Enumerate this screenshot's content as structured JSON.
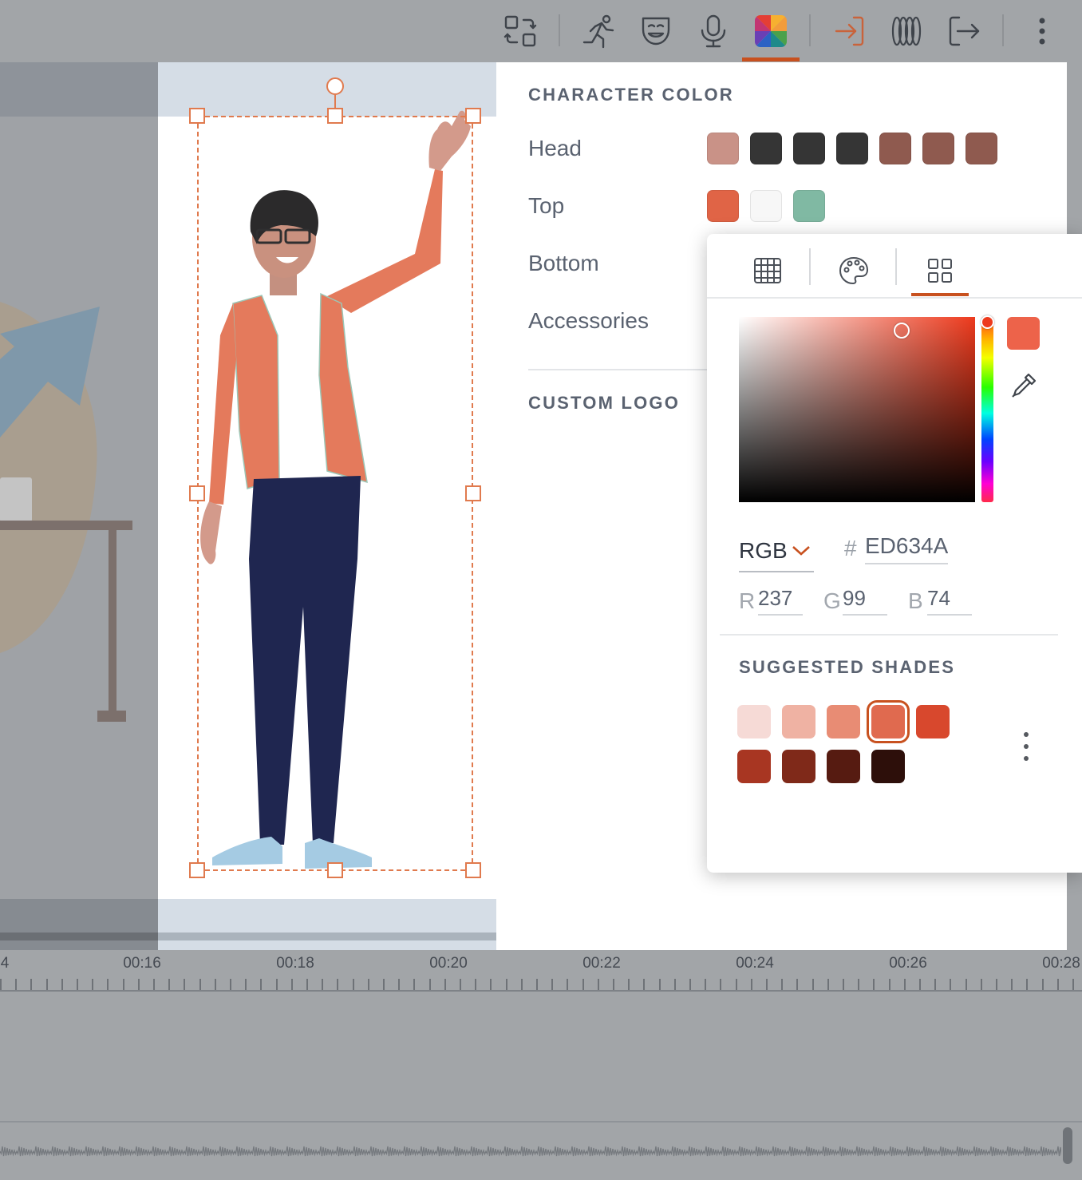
{
  "toolbar": {
    "icons": [
      "swap-icon",
      "motion-icon",
      "expression-icon",
      "microphone-icon",
      "color-icon",
      "enter-icon",
      "exit-loop-icon",
      "exit-icon",
      "more-icon"
    ],
    "active": "color-icon",
    "accent": "#c8511f"
  },
  "panel": {
    "character_color_title": "CHARACTER COLOR",
    "rows": [
      {
        "label": "Head",
        "swatches": [
          "#c99287",
          "#353535",
          "#353535",
          "#353535",
          "#8f5a4f",
          "#8f5a4f",
          "#8f5a4f"
        ]
      },
      {
        "label": "Top",
        "swatches": [
          "#e06446",
          "#f7f7f7",
          "#80b9a3"
        ]
      },
      {
        "label": "Bottom",
        "swatches": []
      },
      {
        "label": "Accessories",
        "swatches": []
      }
    ],
    "custom_logo_title": "CUSTOM LOGO"
  },
  "picker": {
    "tabs": [
      "pattern-icon",
      "palette-icon",
      "grid-icon"
    ],
    "active_tab": "grid-icon",
    "current_color": "#ED634A",
    "mode": "RGB",
    "hex_prefix": "#",
    "hex_value": "ED634A",
    "r_label": "R",
    "r_value": "237",
    "g_label": "G",
    "g_value": "99",
    "b_label": "B",
    "b_value": "74",
    "shades_title": "SUGGESTED SHADES",
    "shades": [
      "#f6dad6",
      "#efb2a3",
      "#e88c74",
      "#e06a4f",
      "#d8482d",
      "#a83622",
      "#7f2919",
      "#561b11",
      "#2d0f0a"
    ],
    "selected_shade": 3
  },
  "timeline": {
    "labels": [
      "4",
      "00:16",
      "00:18",
      "00:20",
      "00:22",
      "00:24",
      "00:26",
      "00:28"
    ]
  }
}
